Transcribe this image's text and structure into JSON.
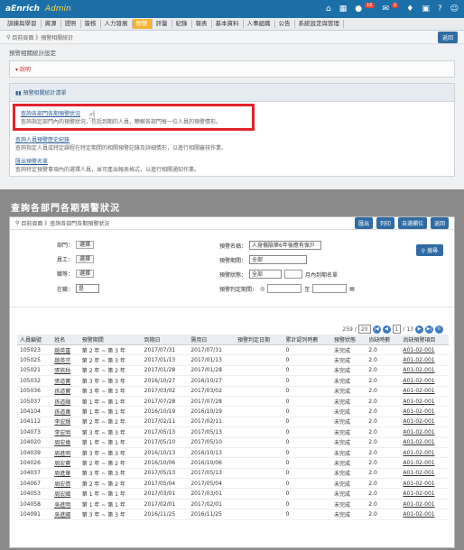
{
  "header": {
    "logo": "aEnrich",
    "product": "Admin",
    "mail_count": "16",
    "notice_count": "2"
  },
  "nav": [
    "訓練與學習",
    "資源",
    "證照",
    "簽核",
    "人力發展",
    "預警",
    "評量",
    "紀錄",
    "報表",
    "基本資料",
    "人事組織",
    "公告",
    "系統設定與管理"
  ],
  "breadcrumb": "目前頁面 》預警相關統計",
  "back": "返回",
  "page_title": "預警相關統計設定",
  "note_label": "說明",
  "list_title": "預警相關統計清單",
  "items": [
    {
      "link": "查詢各部門各期預警狀況",
      "desc": "查詢指定部門內的預警狀況，包括到期的人員，瞭解各部門每一位人員的預警情形。"
    },
    {
      "link": "查詢人員預警歷史紀錄",
      "desc": "查詢指定人員或特定課程在特定期間的相關預警記錄及詳細情形，以進行相關審核作業。"
    },
    {
      "link": "匯出預警名單",
      "desc": "查詢特定預警事項內的選擇人員，並可產出報表格式，以進行相關通知作業。"
    }
  ],
  "overlay_title": "查詢各部門各期預警狀況",
  "win": {
    "breadcrumb": "目前頁面 》查詢各部門各期預警狀況",
    "buttons": [
      "匯出",
      "列印",
      "自選欄位",
      "返回"
    ]
  },
  "form": {
    "dept_label": "部門：",
    "staff_label": "員工：",
    "title_label": "職等：",
    "status_label": "在職：",
    "pick": "選擇",
    "status_value": "是",
    "item_label": "預警名稱：",
    "item_value": "人身傷險第6年後應有保戶",
    "period_label": "預警期間：",
    "period_value": "全部",
    "state_label": "預警狀態：",
    "state_value": "全部",
    "monthly": "月內到期名單",
    "date_label": "預警判定期間：",
    "to": "至",
    "search": "搜尋"
  },
  "pagination": {
    "total": "259",
    "per_page": "20",
    "page": "1",
    "pages": "13"
  },
  "columns": [
    "人員編號",
    "姓名",
    "預警期間",
    "到期日",
    "需用日",
    "預警判定日期",
    "累計認列時數",
    "預警狀態",
    "尚缺時數",
    "尚缺預警項目"
  ],
  "rows": [
    [
      "105023",
      "趙英富",
      "第 2 年 ~ 第 3 年",
      "2017/07/31",
      "2017/07/31",
      "0",
      "未完成",
      "2.0",
      "A01-02-001"
    ],
    [
      "105025",
      "趙英宗",
      "第 2 年 ~ 第 3 年",
      "2017/01/13",
      "2017/01/13",
      "0",
      "未完成",
      "2.0",
      "A01-02-001"
    ],
    [
      "105021",
      "張依秋",
      "第 2 年 ~ 第 2 年",
      "2017/01/28",
      "2017/01/28",
      "0",
      "未完成",
      "2.0",
      "A01-02-001"
    ],
    [
      "105032",
      "張道寶",
      "第 3 年 ~ 第 3 年",
      "2016/10/27",
      "2016/10/27",
      "0",
      "未完成",
      "2.0",
      "A01-02-001"
    ],
    [
      "105036",
      "孫道寶",
      "第 3 年 ~ 第 3 年",
      "2017/03/02",
      "2017/03/02",
      "0",
      "未完成",
      "2.0",
      "A01-02-001"
    ],
    [
      "105037",
      "孫道順",
      "第 1 年 ~ 第 1 年",
      "2017/07/28",
      "2017/07/28",
      "0",
      "未完成",
      "2.0",
      "A01-02-001"
    ],
    [
      "104104",
      "孫道萬",
      "第 1 年 ~ 第 1 年",
      "2016/10/19",
      "2016/10/19",
      "0",
      "未完成",
      "2.0",
      "A01-02-001"
    ],
    [
      "104112",
      "李宏輝",
      "第 2 年 ~ 第 2 年",
      "2017/02/11",
      "2017/02/11",
      "0",
      "未完成",
      "2.0",
      "A01-02-001"
    ],
    [
      "104073",
      "李宏明",
      "第 3 年 ~ 第 3 年",
      "2017/05/13",
      "2017/05/13",
      "0",
      "未完成",
      "2.0",
      "A01-02-001"
    ],
    [
      "104020",
      "周宏倫",
      "第 1 年 ~ 第 1 年",
      "2017/05/10",
      "2017/05/10",
      "0",
      "未完成",
      "2.0",
      "A01-02-001"
    ],
    [
      "104039",
      "周進明",
      "第 3 年 ~ 第 3 年",
      "2016/10/13",
      "2016/10/13",
      "0",
      "未完成",
      "2.0",
      "A01-02-001"
    ],
    [
      "104026",
      "周宏寶",
      "第 2 年 ~ 第 2 年",
      "2016/10/06",
      "2016/10/06",
      "0",
      "未完成",
      "2.0",
      "A01-02-001"
    ],
    [
      "104037",
      "周進華",
      "第 3 年 ~ 第 3 年",
      "2017/05/13",
      "2017/05/13",
      "0",
      "未完成",
      "2.0",
      "A01-02-001"
    ],
    [
      "104067",
      "周宏倩",
      "第 2 年 ~ 第 2 年",
      "2017/05/04",
      "2017/05/04",
      "0",
      "未完成",
      "2.0",
      "A01-02-001"
    ],
    [
      "104053",
      "周宏國",
      "第 1 年 ~ 第 1 年",
      "2017/03/01",
      "2017/03/01",
      "0",
      "未完成",
      "2.0",
      "A01-02-001"
    ],
    [
      "104058",
      "吳進明",
      "第 1 年 ~ 第 1 年",
      "2017/02/01",
      "2017/02/01",
      "0",
      "未完成",
      "2.0",
      "A01-02-001"
    ],
    [
      "104091",
      "吳進國",
      "第 3 年 ~ 第 3 年",
      "2016/11/25",
      "2016/11/25",
      "0",
      "未完成",
      "2.0",
      "A01-02-001"
    ]
  ]
}
